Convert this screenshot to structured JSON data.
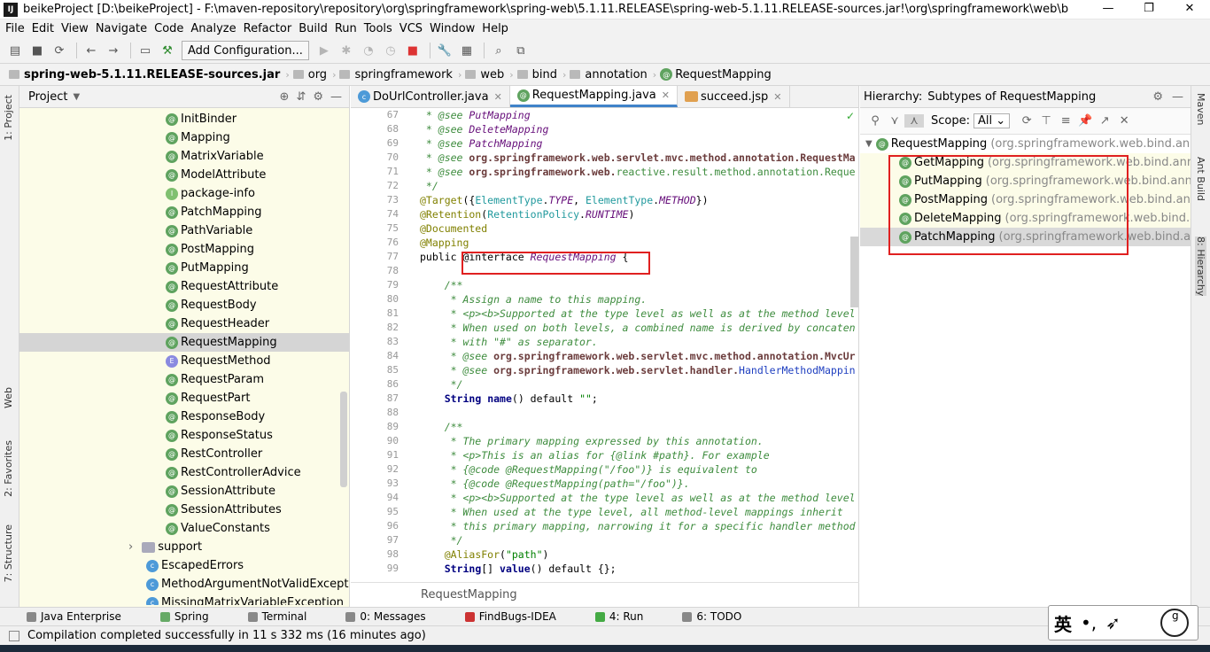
{
  "window": {
    "title": "beikeProject [D:\\beikeProject] - F:\\maven-repository\\repository\\org\\springframework\\spring-web\\5.1.11.RELEASE\\spring-web-5.1.11.RELEASE-sources.jar!\\org\\springframework\\web\\bind\\annotation\\Requ...",
    "logo": "IJ",
    "minimize": "—",
    "maximize": "❐",
    "close": "✕"
  },
  "menu": [
    "File",
    "Edit",
    "View",
    "Navigate",
    "Code",
    "Analyze",
    "Refactor",
    "Build",
    "Run",
    "Tools",
    "VCS",
    "Window",
    "Help"
  ],
  "toolbar": {
    "add_configuration": "Add Configuration..."
  },
  "breadcrumb": [
    "spring-web-5.1.11.RELEASE-sources.jar",
    "org",
    "springframework",
    "web",
    "bind",
    "annotation",
    "RequestMapping"
  ],
  "left_strip": {
    "project": "1: Project",
    "web": "Web",
    "favorites": "2: Favorites",
    "structure": "7: Structure"
  },
  "right_strip": {
    "maven": "Maven",
    "ant": "Ant Build",
    "hierarchy": "8: Hierarchy"
  },
  "project_panel": {
    "title": "Project",
    "items": [
      {
        "label": "InitBinder",
        "kind": "a"
      },
      {
        "label": "Mapping",
        "kind": "a"
      },
      {
        "label": "MatrixVariable",
        "kind": "a"
      },
      {
        "label": "ModelAttribute",
        "kind": "a"
      },
      {
        "label": "package-info",
        "kind": "i"
      },
      {
        "label": "PatchMapping",
        "kind": "a"
      },
      {
        "label": "PathVariable",
        "kind": "a"
      },
      {
        "label": "PostMapping",
        "kind": "a"
      },
      {
        "label": "PutMapping",
        "kind": "a"
      },
      {
        "label": "RequestAttribute",
        "kind": "a"
      },
      {
        "label": "RequestBody",
        "kind": "a"
      },
      {
        "label": "RequestHeader",
        "kind": "a"
      },
      {
        "label": "RequestMapping",
        "kind": "a",
        "selected": true
      },
      {
        "label": "RequestMethod",
        "kind": "e"
      },
      {
        "label": "RequestParam",
        "kind": "a"
      },
      {
        "label": "RequestPart",
        "kind": "a"
      },
      {
        "label": "ResponseBody",
        "kind": "a"
      },
      {
        "label": "ResponseStatus",
        "kind": "a"
      },
      {
        "label": "RestController",
        "kind": "a"
      },
      {
        "label": "RestControllerAdvice",
        "kind": "a"
      },
      {
        "label": "SessionAttribute",
        "kind": "a"
      },
      {
        "label": "SessionAttributes",
        "kind": "a"
      },
      {
        "label": "ValueConstants",
        "kind": "a"
      },
      {
        "label": "support",
        "kind": "f",
        "indent": "folder"
      },
      {
        "label": "EscapedErrors",
        "kind": "c",
        "indent": "class"
      },
      {
        "label": "MethodArgumentNotValidException",
        "kind": "c",
        "indent": "class"
      },
      {
        "label": "MissingMatrixVariableException",
        "kind": "c",
        "indent": "class"
      }
    ]
  },
  "editor": {
    "tabs": [
      {
        "label": "DoUrlController.java",
        "active": false
      },
      {
        "label": "RequestMapping.java",
        "active": true
      },
      {
        "label": "succeed.jsp",
        "active": false
      }
    ],
    "line_numbers": [
      "67",
      "68",
      "69",
      "70",
      "71",
      "72",
      "73",
      "74",
      "75",
      "76",
      "77",
      "78",
      "79",
      "80",
      "81",
      "82",
      "83",
      "84",
      "85",
      "86",
      "87",
      "88",
      "89",
      "90",
      "91",
      "92",
      "93",
      "94",
      "95",
      "96",
      "97",
      "98",
      "99"
    ],
    "breadcrumb": "RequestMapping"
  },
  "hierarchy": {
    "title": "Hierarchy:",
    "subtitle": "Subtypes of RequestMapping",
    "scope_label": "Scope:",
    "scope_value": "All",
    "root": {
      "name": "RequestMapping",
      "pkg": "(org.springframework.web.bind.ann"
    },
    "children": [
      {
        "name": "GetMapping",
        "pkg": "(org.springframework.web.bind.annot"
      },
      {
        "name": "PutMapping",
        "pkg": "(org.springframework.web.bind.annota"
      },
      {
        "name": "PostMapping",
        "pkg": "(org.springframework.web.bind.anno"
      },
      {
        "name": "DeleteMapping",
        "pkg": "(org.springframework.web.bind.ann"
      },
      {
        "name": "PatchMapping",
        "pkg": "(org.springframework.web.bind.ann"
      }
    ]
  },
  "bottom_tools": [
    "Java Enterprise",
    "Spring",
    "Terminal",
    "0: Messages",
    "FindBugs-IDEA",
    "4: Run",
    "6: TODO"
  ],
  "status": {
    "message": "Compilation completed successfully in 11 s 332 ms (16 minutes ago)"
  },
  "ime": {
    "lang": "英",
    "punct": "•,",
    "tail": "g"
  }
}
